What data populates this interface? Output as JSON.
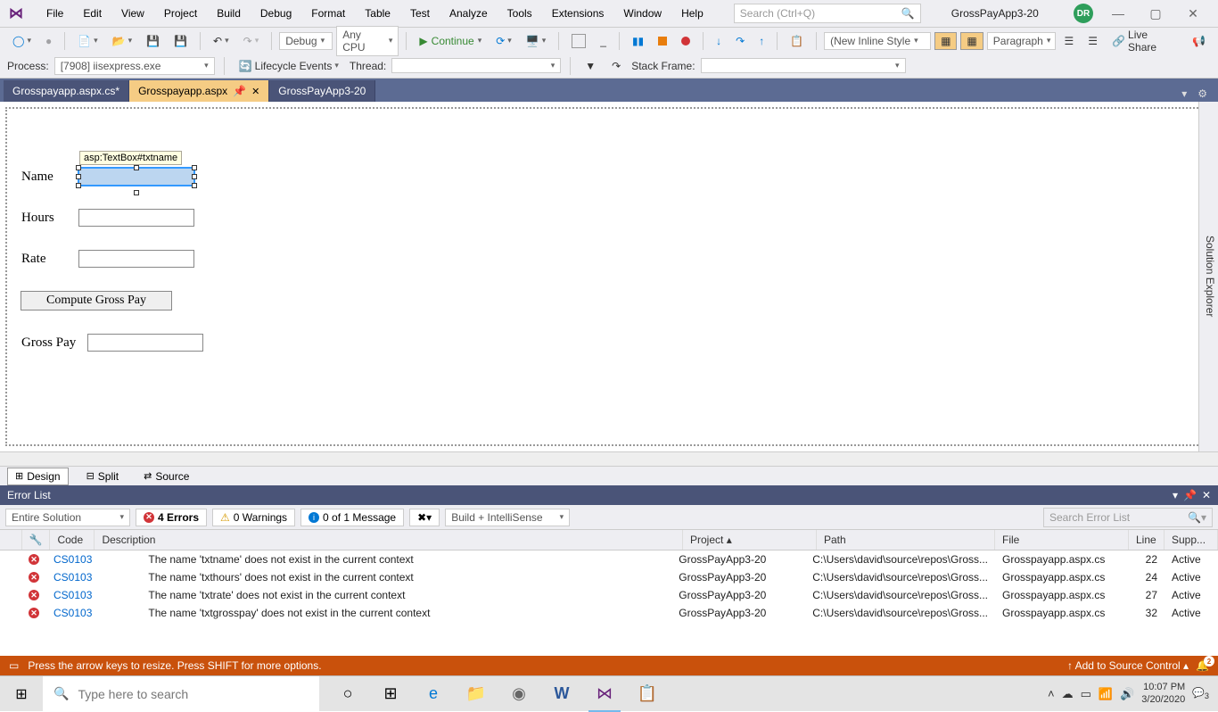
{
  "title": {
    "solution_name": "GrossPayApp3-20",
    "user_initials": "DR"
  },
  "menu": [
    "File",
    "Edit",
    "View",
    "Project",
    "Build",
    "Debug",
    "Format",
    "Table",
    "Test",
    "Analyze",
    "Tools",
    "Extensions",
    "Window",
    "Help"
  ],
  "search": {
    "placeholder": "Search (Ctrl+Q)"
  },
  "toolbar": {
    "config": "Debug",
    "platform": "Any CPU",
    "run_label": "Continue",
    "style_dropdown": "(New Inline Style",
    "format_dropdown": "Paragraph",
    "live_share": "Live Share"
  },
  "toolbar2": {
    "process_label": "Process:",
    "process_value": "[7908] iisexpress.exe",
    "lifecycle": "Lifecycle Events",
    "thread_label": "Thread:",
    "stack_label": "Stack Frame:"
  },
  "tabs": [
    {
      "label": "Grosspayapp.aspx.cs*",
      "active": false
    },
    {
      "label": "Grosspayapp.aspx",
      "active": true,
      "pinned": true
    },
    {
      "label": "GrossPayApp3-20",
      "active": false
    }
  ],
  "designer": {
    "tooltip": "asp:TextBox#txtname",
    "labels": {
      "name": "Name",
      "hours": "Hours",
      "rate": "Rate",
      "grosspay": "Gross Pay"
    },
    "button": "Compute Gross Pay"
  },
  "solution_explorer": "Solution Explorer",
  "view_modes": {
    "design": "Design",
    "split": "Split",
    "source": "Source"
  },
  "error_panel": {
    "title": "Error List",
    "scope": "Entire Solution",
    "errors_count": "4 Errors",
    "warnings_count": "0 Warnings",
    "messages_count": "0 of 1 Message",
    "build_mode": "Build + IntelliSense",
    "search_placeholder": "Search Error List",
    "columns": [
      "",
      "",
      "Code",
      "Description",
      "Project",
      "Path",
      "File",
      "Line",
      "Supp..."
    ],
    "rows": [
      {
        "code": "CS0103",
        "desc": "The name 'txtname' does not exist in the current context",
        "project": "GrossPayApp3-20",
        "path": "C:\\Users\\david\\source\\repos\\Gross...",
        "file": "Grosspayapp.aspx.cs",
        "line": "22",
        "supp": "Active"
      },
      {
        "code": "CS0103",
        "desc": "The name 'txthours' does not exist in the current context",
        "project": "GrossPayApp3-20",
        "path": "C:\\Users\\david\\source\\repos\\Gross...",
        "file": "Grosspayapp.aspx.cs",
        "line": "24",
        "supp": "Active"
      },
      {
        "code": "CS0103",
        "desc": "The name 'txtrate' does not exist in the current context",
        "project": "GrossPayApp3-20",
        "path": "C:\\Users\\david\\source\\repos\\Gross...",
        "file": "Grosspayapp.aspx.cs",
        "line": "27",
        "supp": "Active"
      },
      {
        "code": "CS0103",
        "desc": "The name 'txtgrosspay' does not exist in the current context",
        "project": "GrossPayApp3-20",
        "path": "C:\\Users\\david\\source\\repos\\Gross...",
        "file": "Grosspayapp.aspx.cs",
        "line": "32",
        "supp": "Active"
      }
    ]
  },
  "statusbar": {
    "msg": "Press the arrow keys to resize. Press SHIFT for more options.",
    "source_control": "Add to Source Control",
    "notif": "2"
  },
  "taskbar": {
    "search_placeholder": "Type here to search",
    "time": "10:07 PM",
    "date": "3/20/2020",
    "tray_notif": "3"
  }
}
